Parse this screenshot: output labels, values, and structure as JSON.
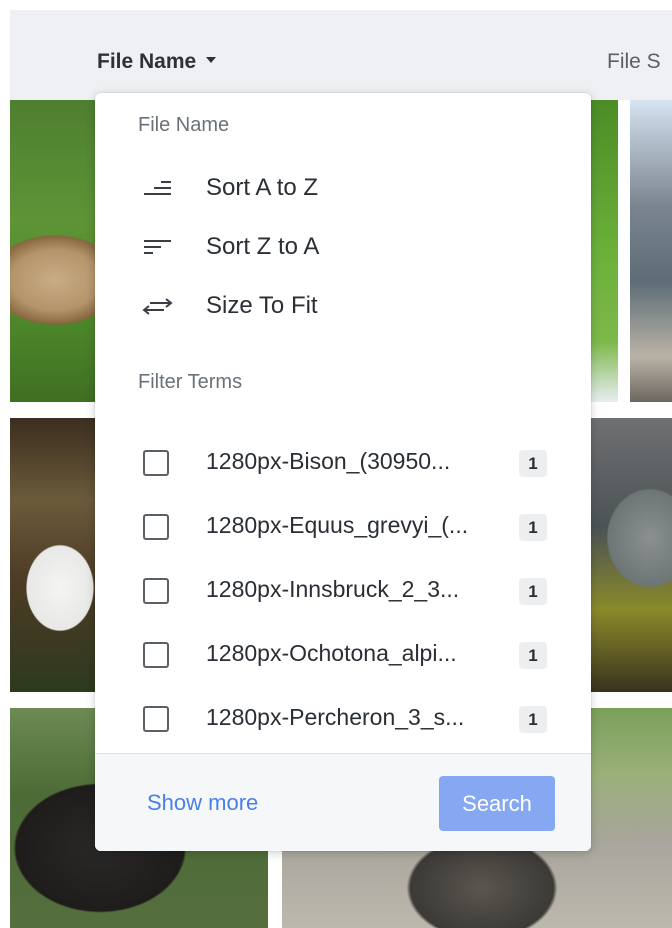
{
  "header": {
    "columns": [
      {
        "label": "File Name"
      },
      {
        "label": "File S"
      }
    ]
  },
  "menu": {
    "section_title": "File Name",
    "items": [
      {
        "label": "Sort A to Z",
        "icon": "sort-ascending-icon"
      },
      {
        "label": "Sort Z to A",
        "icon": "sort-descending-icon"
      },
      {
        "label": "Size To Fit",
        "icon": "resize-horizontal-icon"
      }
    ],
    "filter_title": "Filter Terms",
    "filters": [
      {
        "label": "1280px-Bison_(30950...",
        "count": "1",
        "checked": false
      },
      {
        "label": "1280px-Equus_grevyi_(...",
        "count": "1",
        "checked": false
      },
      {
        "label": "1280px-Innsbruck_2_3...",
        "count": "1",
        "checked": false
      },
      {
        "label": "1280px-Ochotona_alpi...",
        "count": "1",
        "checked": false
      },
      {
        "label": "1280px-Percheron_3_s...",
        "count": "1",
        "checked": false
      }
    ],
    "show_more": "Show more",
    "search": "Search"
  },
  "colors": {
    "accent": "#4a7fe8",
    "search_button": "#86a8f2",
    "header_bg": "#eef0f3"
  }
}
